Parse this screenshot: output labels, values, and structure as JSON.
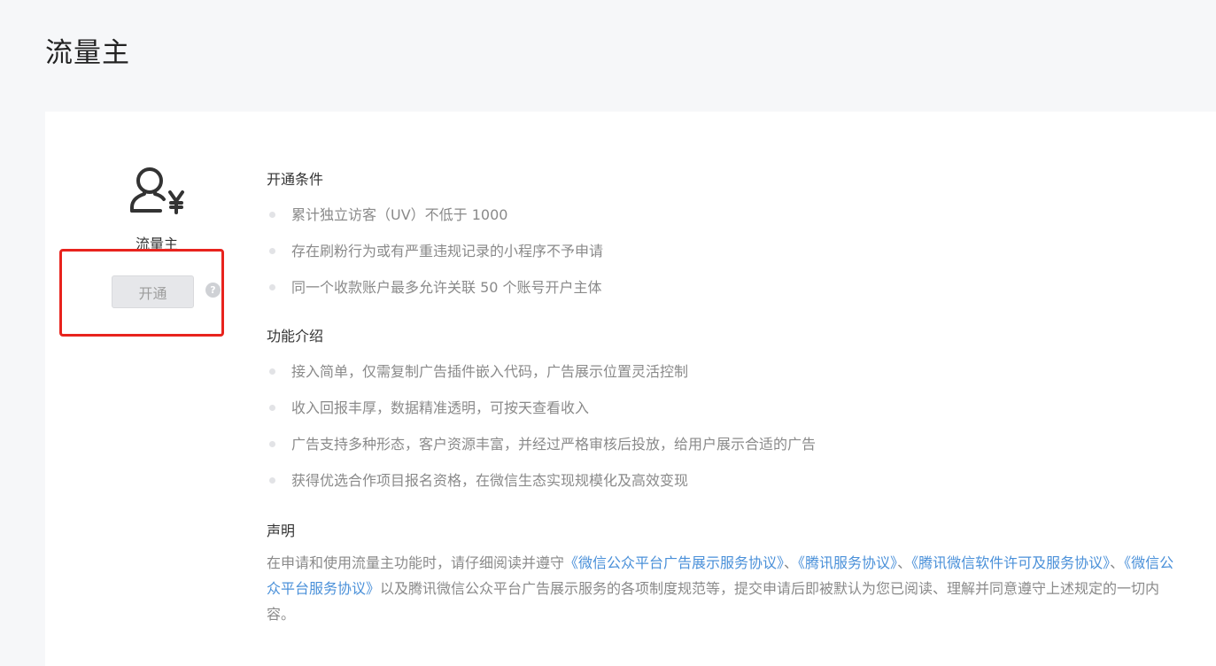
{
  "page": {
    "title": "流量主"
  },
  "feature": {
    "name": "流量主",
    "open_label": "开通",
    "help_glyph": "?",
    "icon": "user-yen-icon"
  },
  "sections": {
    "conditions": {
      "title": "开通条件",
      "items": [
        "累计独立访客（UV）不低于 1000",
        "存在刷粉行为或有严重违规记录的小程序不予申请",
        "同一个收款账户最多允许关联 50 个账号开户主体"
      ]
    },
    "features": {
      "title": "功能介绍",
      "items": [
        "接入简单，仅需复制广告插件嵌入代码，广告展示位置灵活控制",
        "收入回报丰厚，数据精准透明，可按天查看收入",
        "广告支持多种形态，客户资源丰富，并经过严格审核后投放，给用户展示合适的广告",
        "获得优选合作项目报名资格，在微信生态实现规模化及高效变现"
      ]
    },
    "declaration": {
      "title": "声明",
      "text_before": "在申请和使用流量主功能时，请仔细阅读并遵守",
      "link1": "《微信公众平台广告展示服务协议》",
      "sep1": "、",
      "link2": "《腾讯服务协议》",
      "sep2": "、",
      "link3": "《腾讯微信软件许可及服务协议》",
      "sep3": "、",
      "link4": "《微信公众平台服务协议》",
      "text_after": "以及腾讯微信公众平台广告展示服务的各项制度规范等，提交申请后即被默认为您已阅读、理解并同意遵守上述规定的一切内容。"
    }
  },
  "colors": {
    "link": "#4a90d9",
    "highlight": "#e8231d",
    "muted_text": "#8a8a8a"
  }
}
